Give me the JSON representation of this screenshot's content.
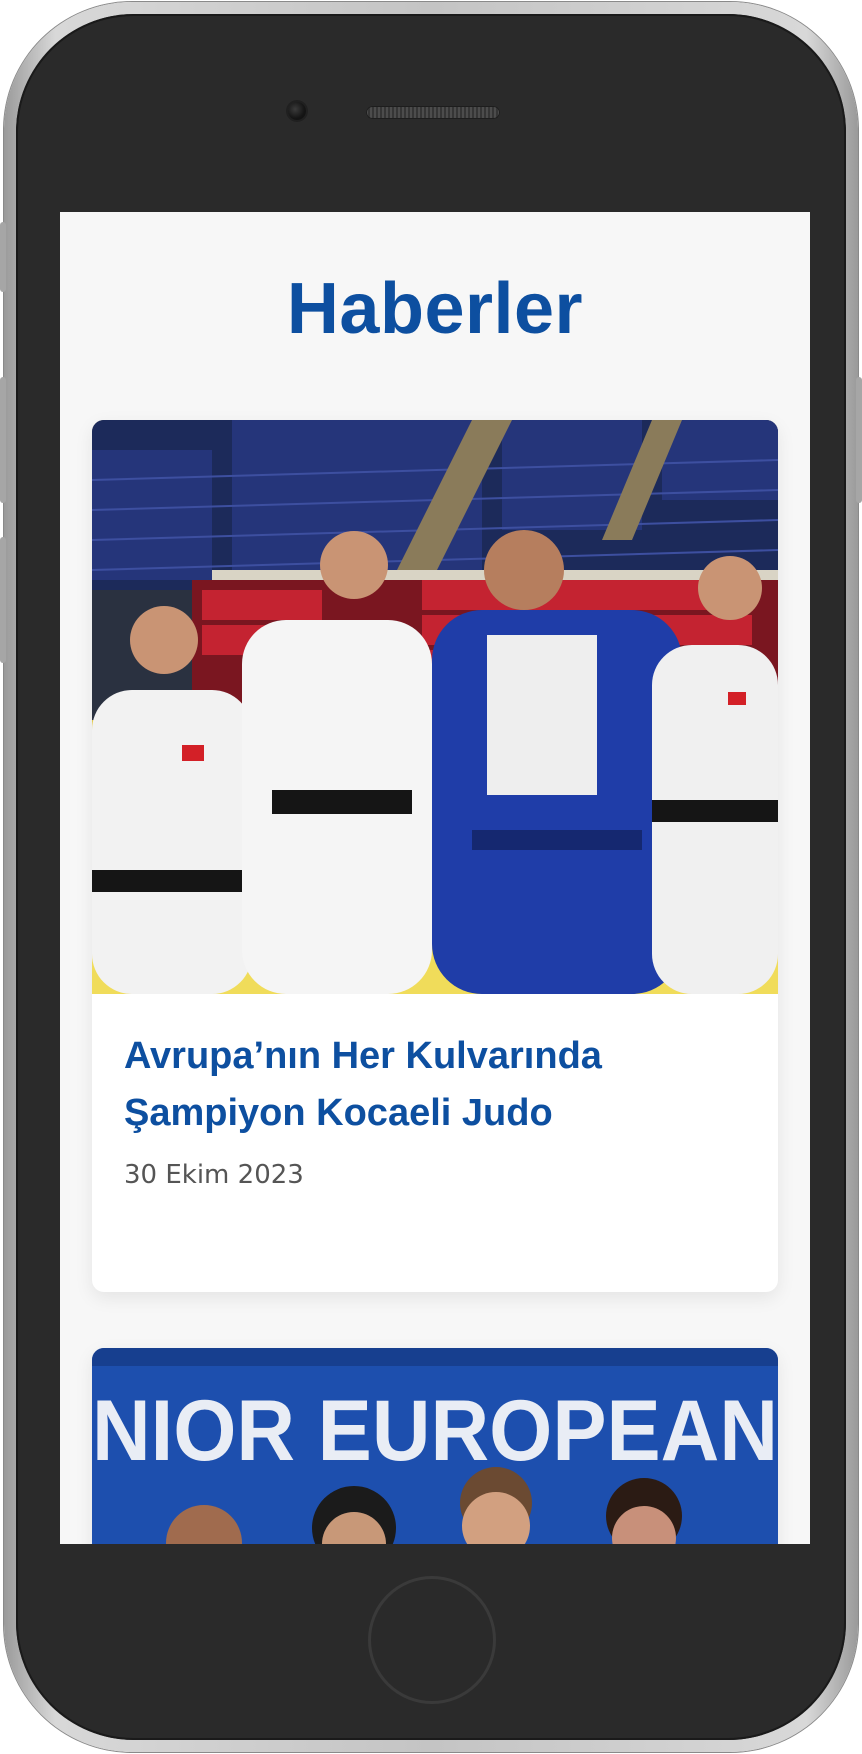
{
  "page": {
    "title": "Haberler"
  },
  "news": [
    {
      "title_line1": "Avrupa’nın Her Kulvarında",
      "title_line2": "Şampiyon Kocaeli Judo",
      "date": "30 Ekim 2023",
      "image": "photo-judo-team-in-arena"
    },
    {
      "banner_text": "NIOR EUROPEAN",
      "image": "photo-junior-european-podium"
    }
  ],
  "colors": {
    "accent": "#0d4fa0",
    "date_text": "#555555",
    "screen_bg": "#f7f7f7",
    "phone_body": "#2a2a2a"
  }
}
